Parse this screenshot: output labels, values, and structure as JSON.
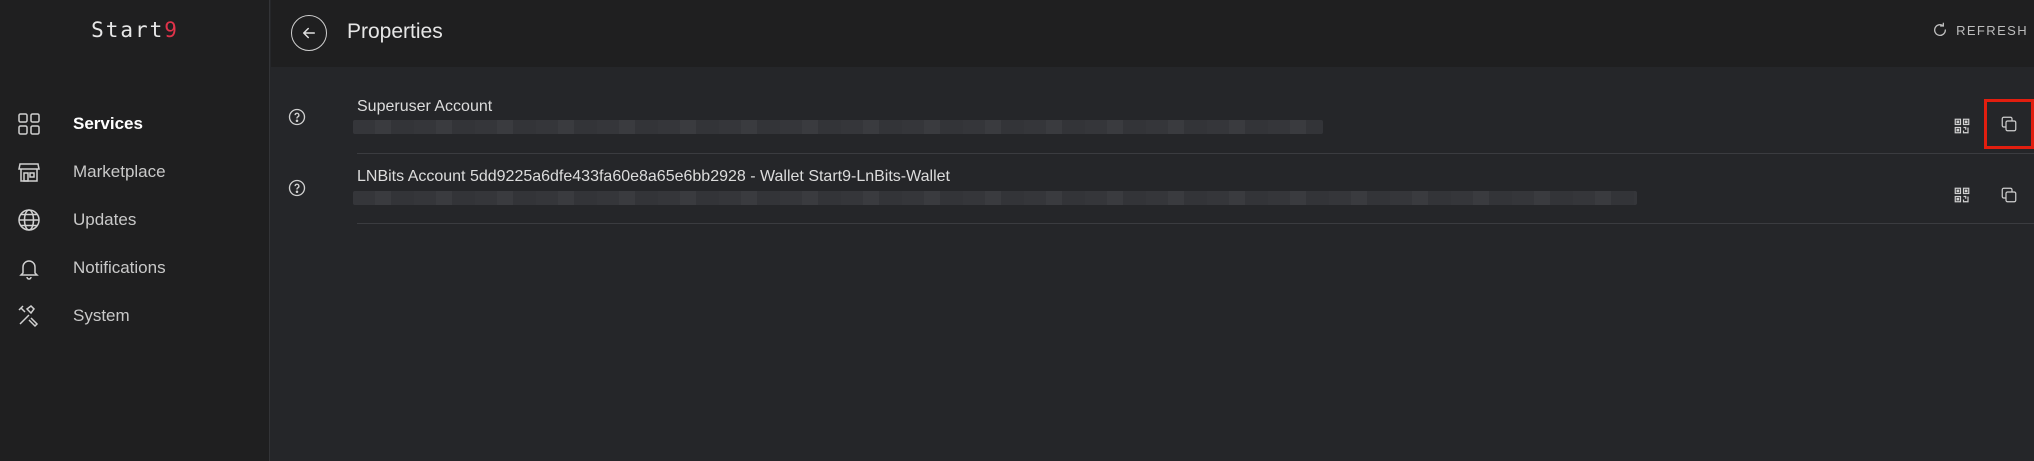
{
  "app": {
    "logo_text": "Start",
    "logo_accent": "9",
    "accent_color": "#e0334a"
  },
  "sidebar": {
    "items": [
      {
        "label": "Services",
        "icon": "grid-icon",
        "active": true
      },
      {
        "label": "Marketplace",
        "icon": "storefront-icon",
        "active": false
      },
      {
        "label": "Updates",
        "icon": "globe-icon",
        "active": false
      },
      {
        "label": "Notifications",
        "icon": "bell-icon",
        "active": false
      },
      {
        "label": "System",
        "icon": "tools-icon",
        "active": false
      }
    ]
  },
  "header": {
    "title": "Properties",
    "refresh_label": "REFRESH"
  },
  "properties": [
    {
      "name": "Superuser Account",
      "value_hidden": true,
      "actions": [
        "qr-code-icon",
        "copy-icon"
      ]
    },
    {
      "name": "LNBits Account 5dd9225a6dfe433fa60e8a65e6bb2928 - Wallet Start9-LnBits-Wallet",
      "value_hidden": true,
      "actions": [
        "qr-code-icon",
        "copy-icon"
      ]
    }
  ],
  "highlight_color": "#e21e0f"
}
